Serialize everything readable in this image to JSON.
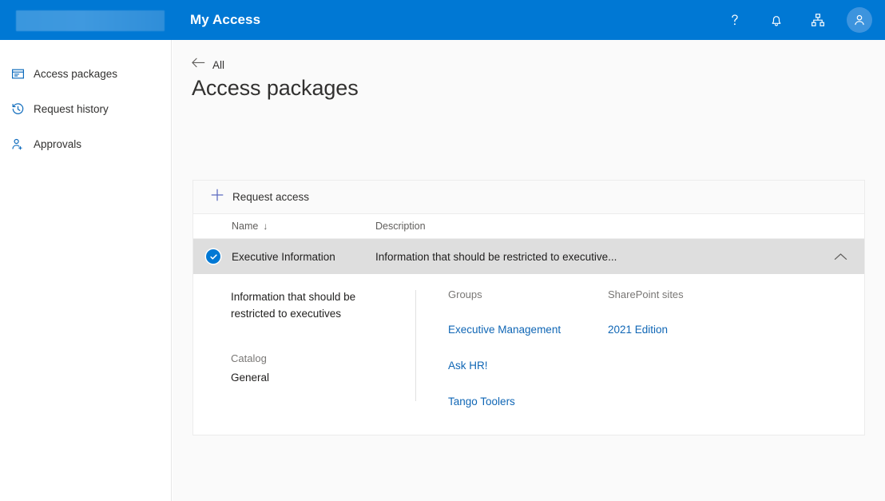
{
  "header": {
    "app_title": "My Access",
    "brand_logo": "redacted-logo",
    "accent_color": "#0078d4",
    "actions": [
      {
        "name": "help-icon",
        "label": "Help"
      },
      {
        "name": "notifications-icon",
        "label": "Notifications"
      },
      {
        "name": "org-hierarchy-icon",
        "label": "Organization"
      },
      {
        "name": "user-avatar",
        "label": "Account"
      }
    ]
  },
  "sidebar": {
    "items": [
      {
        "label": "Access packages",
        "icon": "access-package-icon"
      },
      {
        "label": "Request history",
        "icon": "history-clock-icon"
      },
      {
        "label": "Approvals",
        "icon": "person-add-icon"
      }
    ]
  },
  "breadcrumb": {
    "back_label": "All"
  },
  "page": {
    "title": "Access packages"
  },
  "command_bar": {
    "request_access_label": "Request access"
  },
  "table": {
    "columns": {
      "name": "Name",
      "name_sort": "↓",
      "description": "Description"
    },
    "rows": [
      {
        "selected": true,
        "name": "Executive Information",
        "description_truncated": "Information that should be restricted to executive...",
        "expanded": true,
        "detail": {
          "description": "Information that should be restricted to executives",
          "catalog_label": "Catalog",
          "catalog_value": "General",
          "groups_heading": "Groups",
          "groups": [
            "Executive Management",
            "Ask HR!",
            "Tango Toolers"
          ],
          "sharepoint_heading": "SharePoint sites",
          "sharepoint_sites": [
            "2021 Edition"
          ]
        }
      }
    ]
  },
  "colors": {
    "header_blue": "#0078d4",
    "link_blue": "#0f66b5",
    "selected_row": "#dedede",
    "plus_icon": "#5c6bc0",
    "page_background": "#fafafa"
  }
}
